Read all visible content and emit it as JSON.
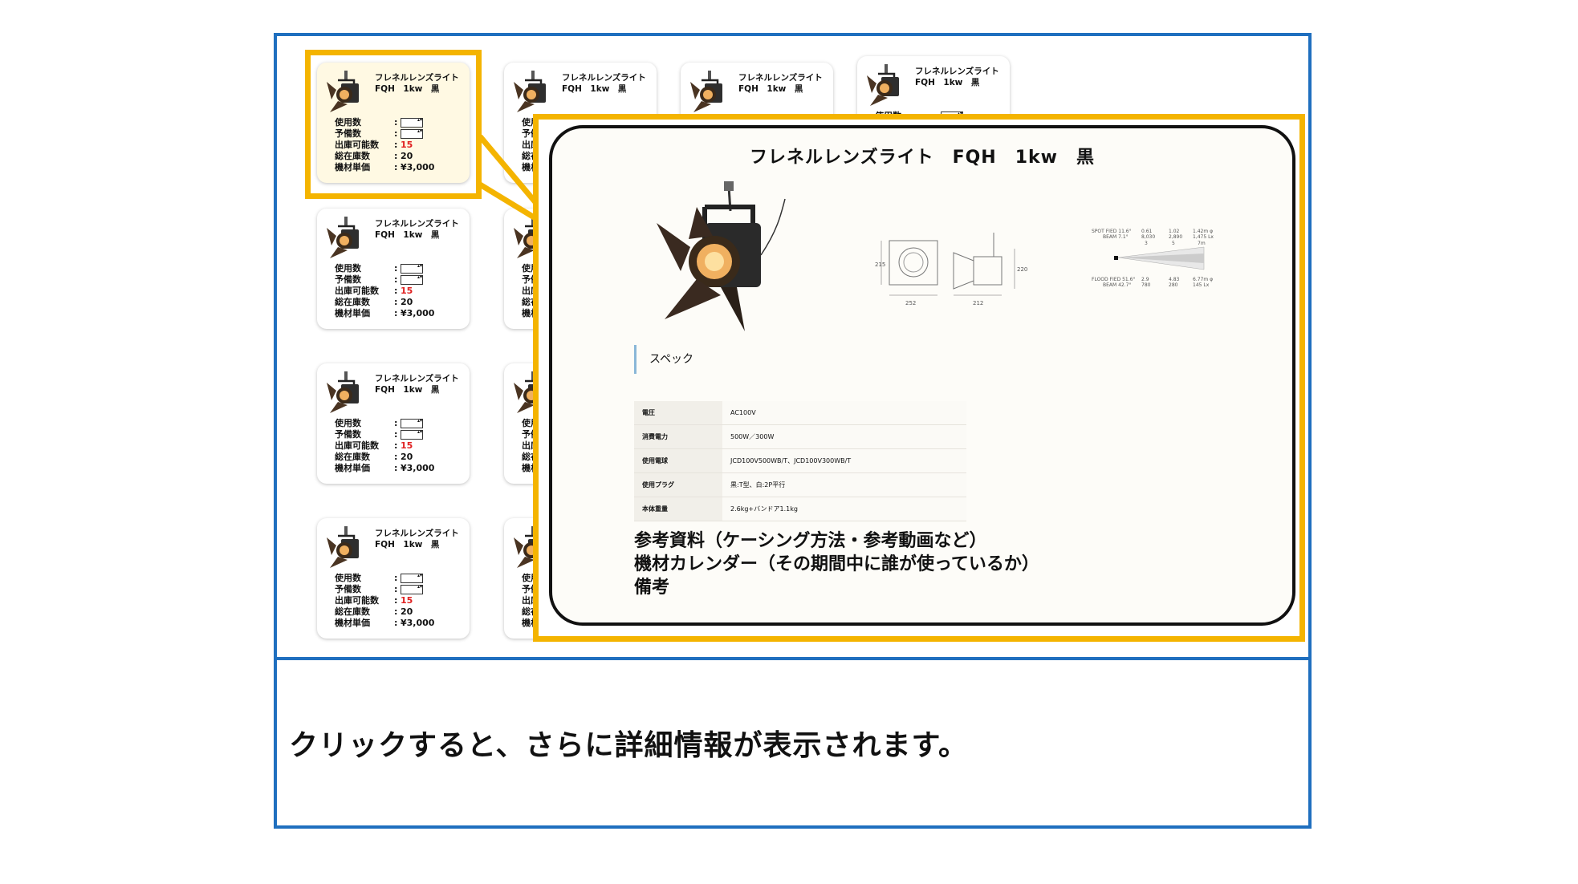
{
  "caption": "クリックすると、さらに詳細情報が表示されます。",
  "card": {
    "title_line1": "フレネルレンズライト",
    "title_line2": "FQH　1kw　黒",
    "labels": [
      "使用数",
      "予備数",
      "出庫可能数",
      "総在庫数",
      "機材単価"
    ],
    "available": "15",
    "total": "20",
    "price": "¥3,000",
    "colon": ":"
  },
  "detail": {
    "title": "フレネルレンズライト　FQH　1kw　黒",
    "spec_heading": "スペック",
    "spec_rows": [
      {
        "key": "電圧",
        "value": "AC100V"
      },
      {
        "key": "消費電力",
        "value": "500W／300W"
      },
      {
        "key": "使用電球",
        "value": "JCD100V500WB/T、JCD100V300WB/T"
      },
      {
        "key": "使用プラグ",
        "value": "黒:T型、白:2P平行"
      },
      {
        "key": "本体重量",
        "value": "2.6kg+バンドア1.1kg"
      }
    ],
    "notes": [
      "参考資料（ケーシング方法・参考動画など）",
      "機材カレンダー（その期間中に誰が使っているか）",
      "備考"
    ],
    "drawing": {
      "dim_h1": "215",
      "dim_w1": "252",
      "dim_w2": "212",
      "dim_h2": "220"
    },
    "beam": {
      "spot_label": "SPOT FIED 11.6°",
      "spot_beam": "BEAM 7.1°",
      "flood_label": "FLOOD FIED 51.6°",
      "flood_beam": "BEAM 42.7°",
      "spot_cols": [
        "0.61",
        "1.02",
        "1.42m φ"
      ],
      "spot_lux": [
        "8,030",
        "2,890",
        "1,475 Lx"
      ],
      "dist": [
        "3",
        "5",
        "7m"
      ],
      "flood_cols": [
        "2.9",
        "4.83",
        "6.77m φ"
      ],
      "flood_lux": [
        "780",
        "280",
        "145 Lx"
      ]
    }
  },
  "colors": {
    "frame": "#1f6fbf",
    "highlight": "#f4b400",
    "red": "#e02020"
  }
}
